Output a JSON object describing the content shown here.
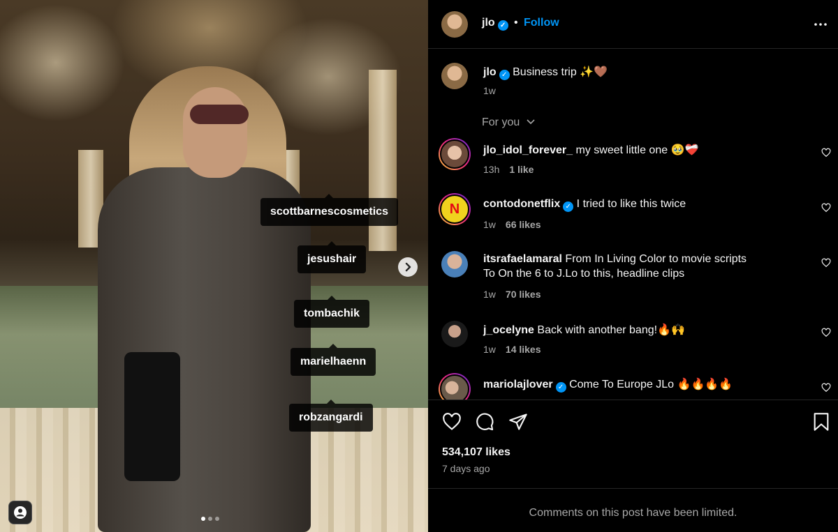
{
  "post": {
    "username": "jlo",
    "verified": true,
    "follow_label": "Follow",
    "separator": "•",
    "more_icon": "more-icon",
    "caption": {
      "username": "jlo",
      "text": "Business trip ✨🤎",
      "time": "1w"
    },
    "sort_label": "For you",
    "likes": "534,107 likes",
    "time_ago": "7 days ago",
    "comments_limited": "Comments on this post have been limited."
  },
  "media": {
    "tags": [
      "scottbarnescosmetics",
      "jesushair",
      "tombachik",
      "marielhaenn",
      "robzangardi"
    ],
    "next_icon": "chevron-right-icon",
    "carousel_dots": 3,
    "active_dot": 0
  },
  "comments": [
    {
      "username": "jlo_idol_forever_",
      "verified": false,
      "text": "my sweet little one 🥹❤️‍🩹",
      "time": "13h",
      "likes": "1 like",
      "ring": true
    },
    {
      "username": "contodonetflix",
      "verified": true,
      "text": "I tried to like this twice",
      "time": "1w",
      "likes": "66 likes",
      "ring": true
    },
    {
      "username": "itsrafaelamaral",
      "verified": false,
      "text": "From In Living Color to movie scripts",
      "text2": "To On the 6 to J.Lo to this, headline clips",
      "time": "1w",
      "likes": "70 likes",
      "ring": false
    },
    {
      "username": "j_ocelyne",
      "verified": false,
      "text": "Back with another bang!🔥🙌",
      "time": "1w",
      "likes": "14 likes",
      "ring": false
    },
    {
      "username": "mariolajlover",
      "verified": true,
      "text": "Come To Europe JLo 🔥🔥🔥🔥",
      "time": "",
      "likes": "",
      "ring": true
    }
  ],
  "colors": {
    "accent": "#0095f6",
    "muted": "#a8a8a8",
    "background": "#000000"
  }
}
